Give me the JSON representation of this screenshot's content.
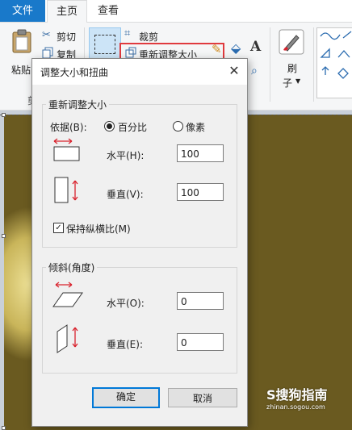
{
  "ribbon": {
    "tabs": [
      "文件",
      "主页",
      "查看"
    ],
    "clipboard": {
      "paste": "粘贴",
      "cut": "剪切",
      "copy": "复制",
      "group": "剪"
    },
    "image": {
      "crop": "裁剪",
      "resize": "重新调整大小"
    },
    "brush": {
      "label1": "刷",
      "label2": "子"
    }
  },
  "dialog": {
    "title": "调整大小和扭曲",
    "close": "✕",
    "resize": {
      "group": "重新调整大小",
      "by_label": "依据(B):",
      "percent": "百分比",
      "pixels": "像素",
      "horizontal_label": "水平(H):",
      "horizontal_value": "100",
      "vertical_label": "垂直(V):",
      "vertical_value": "100",
      "keep_ratio": "保持纵横比(M)"
    },
    "skew": {
      "group": "倾斜(角度)",
      "horizontal_label": "水平(O):",
      "horizontal_value": "0",
      "vertical_label": "垂直(E):",
      "vertical_value": "0"
    },
    "ok": "确定",
    "cancel": "取消"
  },
  "watermark": {
    "name": "S搜狗指南",
    "url": "zhinan.sogou.com"
  },
  "colors": {
    "accent": "#1979ca",
    "highlight": "#e03a3e",
    "arrow": "#d9232e"
  }
}
